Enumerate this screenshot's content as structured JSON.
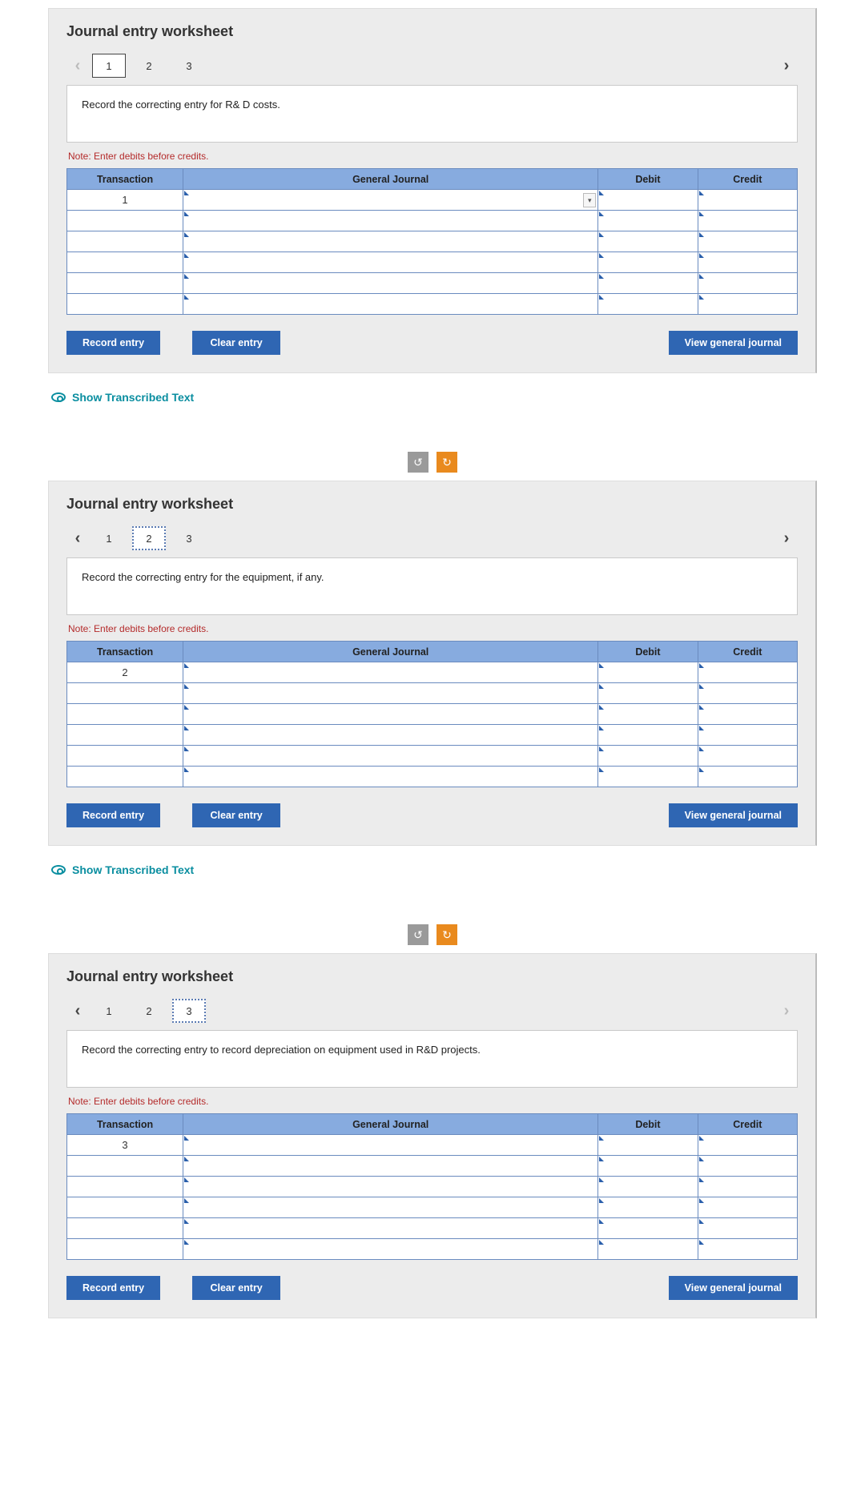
{
  "sheets": [
    {
      "title": "Journal entry worksheet",
      "tabs": [
        "1",
        "2",
        "3"
      ],
      "active_tab": 1,
      "active_style": "solid",
      "prev_light": true,
      "next_light": false,
      "instruction": "Record the correcting entry for R& D costs.",
      "note": "Note: Enter debits before credits.",
      "headers": {
        "tx": "Transaction",
        "gj": "General Journal",
        "debit": "Debit",
        "credit": "Credit"
      },
      "tx_number": "1",
      "show_dropdown": true,
      "buttons": {
        "record": "Record entry",
        "clear": "Clear entry",
        "view": "View general journal"
      },
      "transcribed": "Show Transcribed Text"
    },
    {
      "title": "Journal entry worksheet",
      "tabs": [
        "1",
        "2",
        "3"
      ],
      "active_tab": 2,
      "active_style": "dotted",
      "prev_light": false,
      "next_light": false,
      "instruction": "Record the correcting entry for the equipment, if any.",
      "note": "Note: Enter debits before credits.",
      "headers": {
        "tx": "Transaction",
        "gj": "General Journal",
        "debit": "Debit",
        "credit": "Credit"
      },
      "tx_number": "2",
      "show_dropdown": false,
      "buttons": {
        "record": "Record entry",
        "clear": "Clear entry",
        "view": "View general journal"
      },
      "transcribed": "Show Transcribed Text"
    },
    {
      "title": "Journal entry worksheet",
      "tabs": [
        "1",
        "2",
        "3"
      ],
      "active_tab": 3,
      "active_style": "dotted",
      "prev_light": false,
      "next_light": true,
      "instruction": "Record the correcting entry to record depreciation on equipment used in R&D projects.",
      "note": "Note: Enter debits before credits.",
      "headers": {
        "tx": "Transaction",
        "gj": "General Journal",
        "debit": "Debit",
        "credit": "Credit"
      },
      "tx_number": "3",
      "show_dropdown": false,
      "buttons": {
        "record": "Record entry",
        "clear": "Clear entry",
        "view": "View general journal"
      },
      "transcribed": null
    }
  ]
}
